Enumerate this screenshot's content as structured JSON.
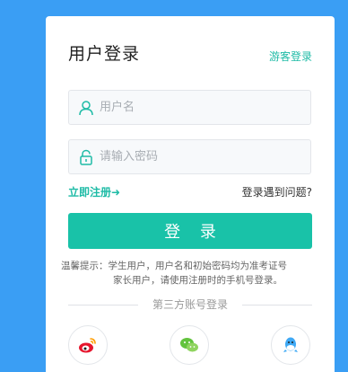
{
  "login": {
    "title": "用户登录",
    "guest_login": "游客登录",
    "username_placeholder": "用户名",
    "password_placeholder": "请输入密码",
    "register": "立即注册➜",
    "problem": "登录遇到问题?",
    "submit": "登 录",
    "tip_line1": "温馨提示：学生用户，用户名和初始密码均为准考证号",
    "tip_line2": "家长用户，请使用注册时的手机号登录。",
    "third_party_label": "第三方账号登录"
  },
  "colors": {
    "background": "#3a9ef4",
    "accent": "#19c2a8",
    "link": "#1ebba6"
  },
  "icons": {
    "username": "user-icon",
    "password": "lock-icon",
    "weibo": "weibo-icon",
    "wechat": "wechat-icon",
    "qq": "qq-icon"
  }
}
